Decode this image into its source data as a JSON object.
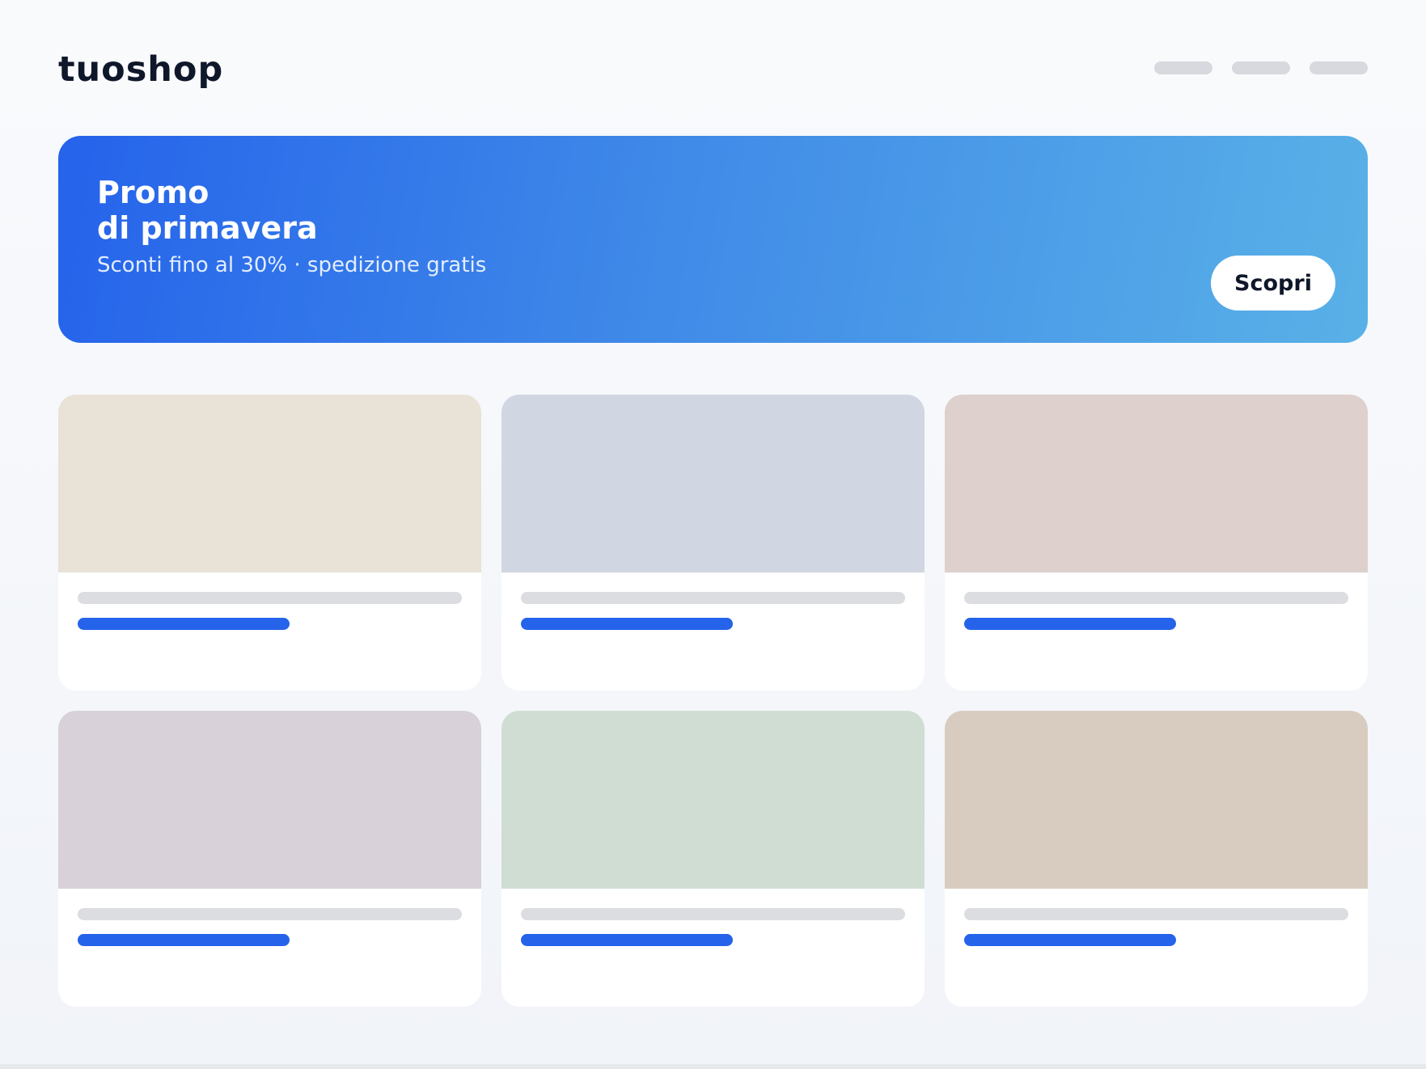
{
  "header": {
    "logo": "tuoshop",
    "nav_items": 3
  },
  "hero": {
    "title_line1": "Promo",
    "title_line2": "di primavera",
    "subtitle": "Sconti fino al 30% · spedizione gratis",
    "cta_label": "Scopri"
  },
  "colors": {
    "accent": "#2563eb",
    "hero_gradient_start": "#2563eb",
    "hero_gradient_end": "#59b1e7",
    "page_background": "#f5f7fb",
    "card_background": "#ffffff",
    "placeholder_line": "#dcdde1",
    "nav_placeholder": "#d8d9de"
  },
  "products": [
    {
      "image_color": "#e9e2d6"
    },
    {
      "image_color": "#d0d7e2"
    },
    {
      "image_color": "#ddd0cd"
    },
    {
      "image_color": "#d8d1d9"
    },
    {
      "image_color": "#d0ddd2"
    },
    {
      "image_color": "#d8ccc0"
    }
  ]
}
